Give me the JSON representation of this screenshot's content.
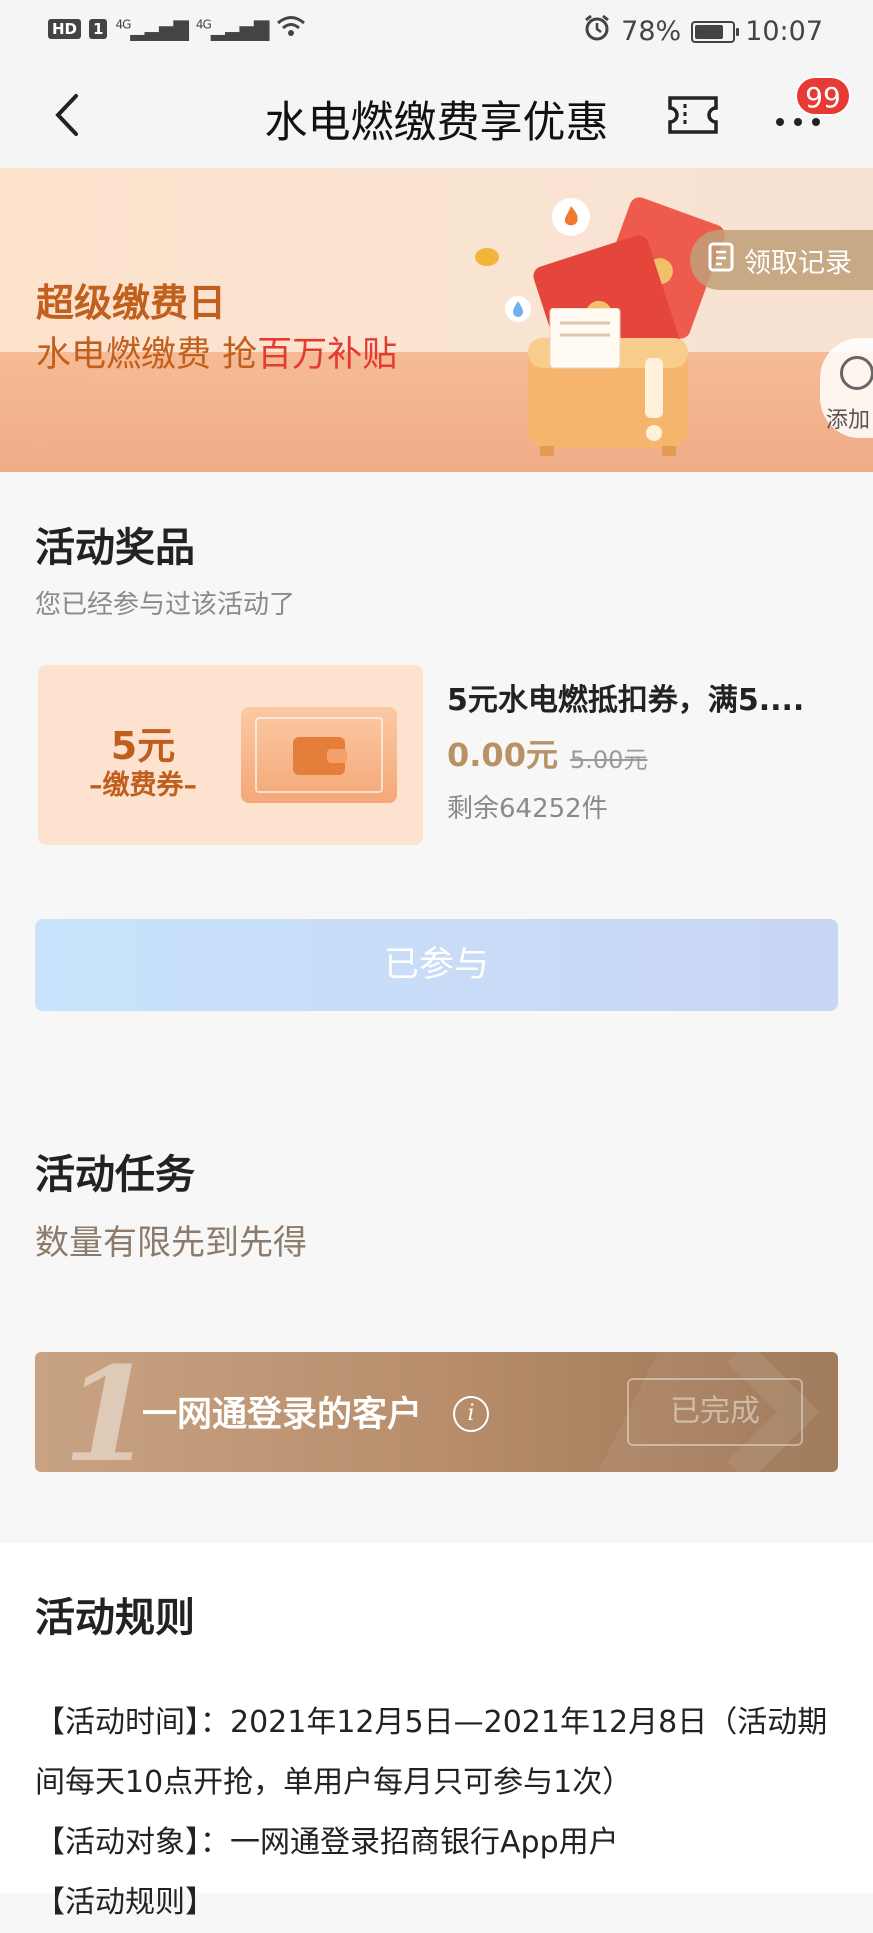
{
  "status_bar": {
    "left_badge_hd": "HD",
    "left_badge_1": "1",
    "signal1": "4G",
    "signal2": "4G",
    "battery_pct": "78%",
    "battery_level": 0.78,
    "time": "10:07",
    "icons": [
      "alarm-icon",
      "wifi-icon",
      "battery-icon"
    ]
  },
  "nav": {
    "title": "水电燃缴费享优惠",
    "badge_count": "99",
    "icons": [
      "back-chevron-icon",
      "ticket-icon",
      "more-dots-icon"
    ]
  },
  "banner": {
    "title": "超级缴费日",
    "sub_prefix": "水电燃缴费 抢",
    "sub_highlight": "百万补贴",
    "record_button": "领取记录",
    "add_button": "添加"
  },
  "prizes": {
    "title": "活动奖品",
    "subtitle": "您已经参与过该活动了",
    "card_amount": "5元",
    "card_type": "–缴费券–",
    "name": "5元水电燃抵扣券，满5....",
    "price": "0.00元",
    "original_price": "5.00元",
    "remaining": "剩余64252件",
    "joined_button": "已参与"
  },
  "tasks": {
    "title": "活动任务",
    "subtitle": "数量有限先到先得",
    "items": [
      {
        "number": "1",
        "label": "一网通登录的客户",
        "status": "已完成"
      }
    ]
  },
  "rules": {
    "title": "活动规则",
    "lines": [
      "【活动时间】：2021年12月5日—2021年12月8日（活动期间每天10点开抢，单用户每月只可参与1次）",
      "【活动对象】：一网通登录招商银行App用户",
      "【活动规则】"
    ]
  },
  "colors": {
    "accent_orange": "#c25f1c",
    "highlight_red": "#e53a2f",
    "gold": "#b89265",
    "badge_red": "#e83a35"
  }
}
